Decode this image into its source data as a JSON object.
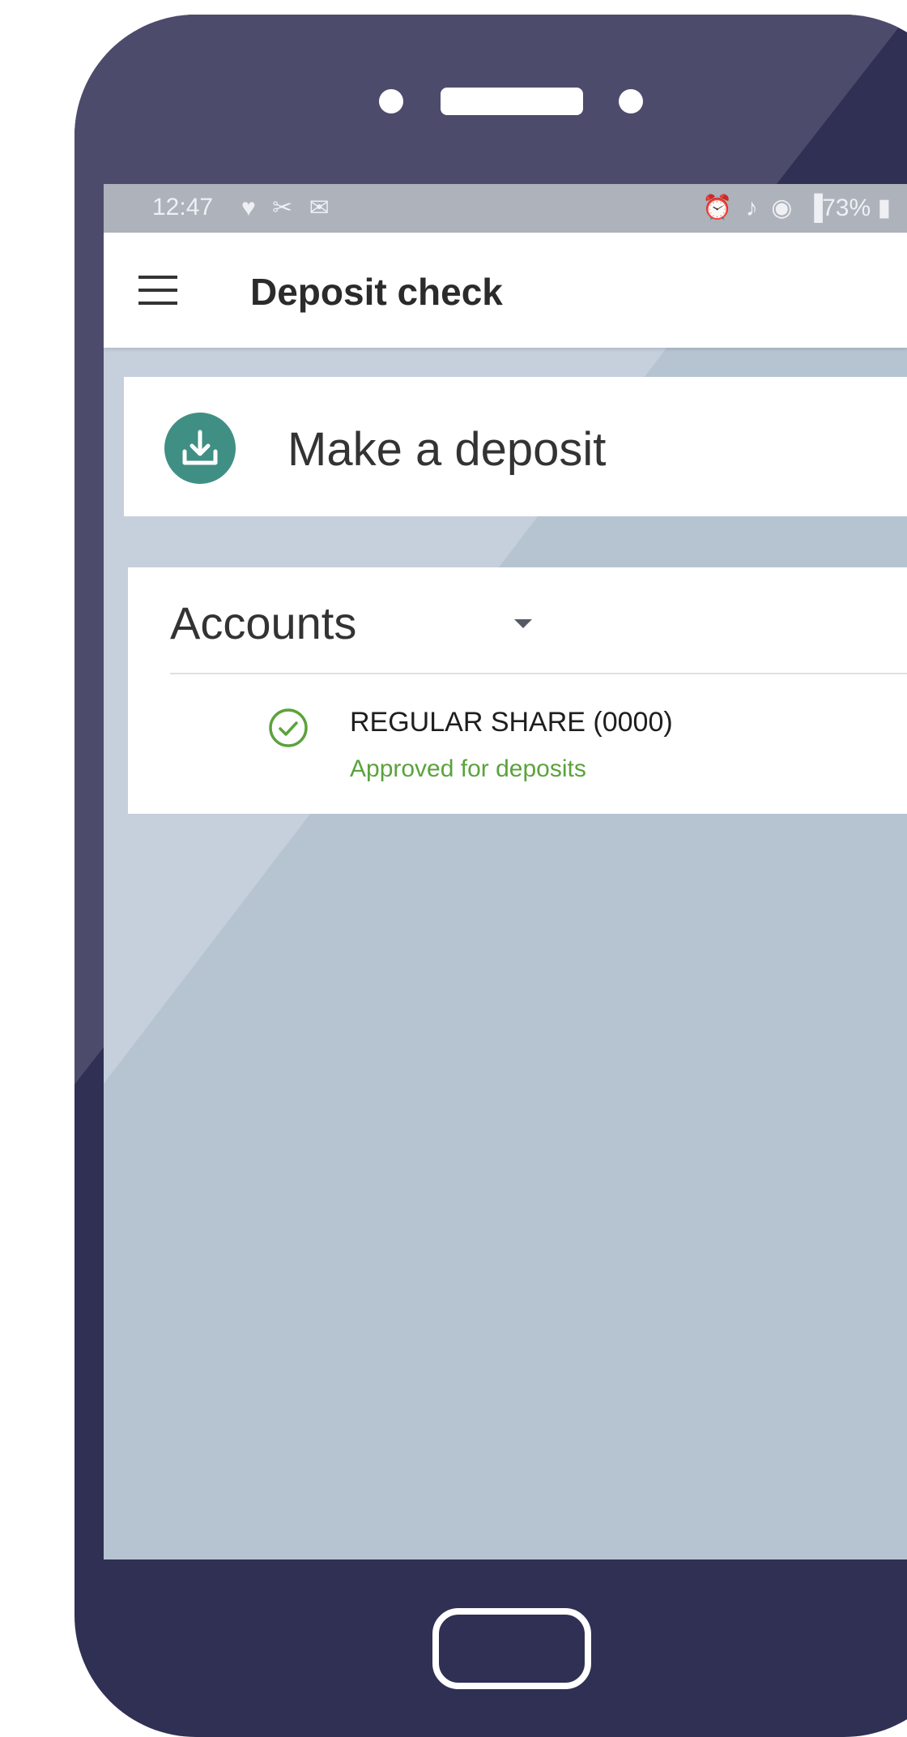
{
  "status_bar": {
    "time": "12:47",
    "left_icons": "♥ ✂ ✉",
    "right_icons": "⏰ ♪ ◉ ▐",
    "battery": "73% ▮"
  },
  "app_bar": {
    "title": "Deposit check"
  },
  "deposit_card": {
    "label": "Make a deposit",
    "icon": "download-tray-icon",
    "icon_color": "#3f8f84"
  },
  "accounts": {
    "header": "Accounts",
    "items": [
      {
        "name": "REGULAR SHARE (0000)",
        "status": "Approved for deposits",
        "status_color": "#5aa33c",
        "icon": "check-circle-icon"
      }
    ]
  },
  "colors": {
    "phone_body": "#2f3054",
    "screen_background": "#b6c4d2",
    "title_text": "#2b2b2b"
  }
}
